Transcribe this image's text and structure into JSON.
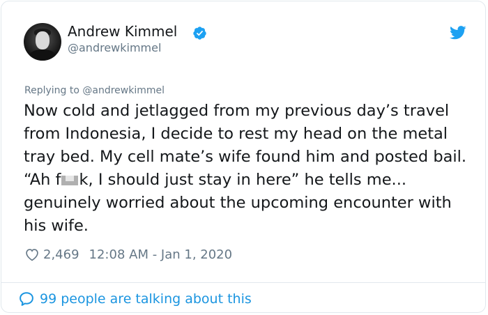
{
  "author": {
    "display_name": "Andrew Kimmel",
    "handle": "@andrewkimmel",
    "verified": true
  },
  "reply_context": "Replying to @andrewkimmel",
  "tweet": {
    "text_before_censor": "Now cold and jetlagged from my previous day’s travel from Indonesia, I decide to rest my head on the metal tray bed. My cell mate’s wife found him and posted bail. “Ah f",
    "text_after_censor": "k, I should just stay in here” he tells me... genuinely worried about the upcoming encounter with his wife."
  },
  "meta": {
    "likes": "2,469",
    "timestamp": "12:08 AM - Jan 1, 2020"
  },
  "footer": {
    "talking_label": "99 people are talking about this"
  },
  "icons": {
    "verified": "verified-badge-icon",
    "brand": "twitter-bird-icon",
    "like": "heart-icon",
    "conversation": "speech-bubble-icon"
  },
  "colors": {
    "accent": "#1da1f2",
    "link": "#1b95e0",
    "secondary_text": "#657786",
    "primary_text": "#14171a"
  }
}
